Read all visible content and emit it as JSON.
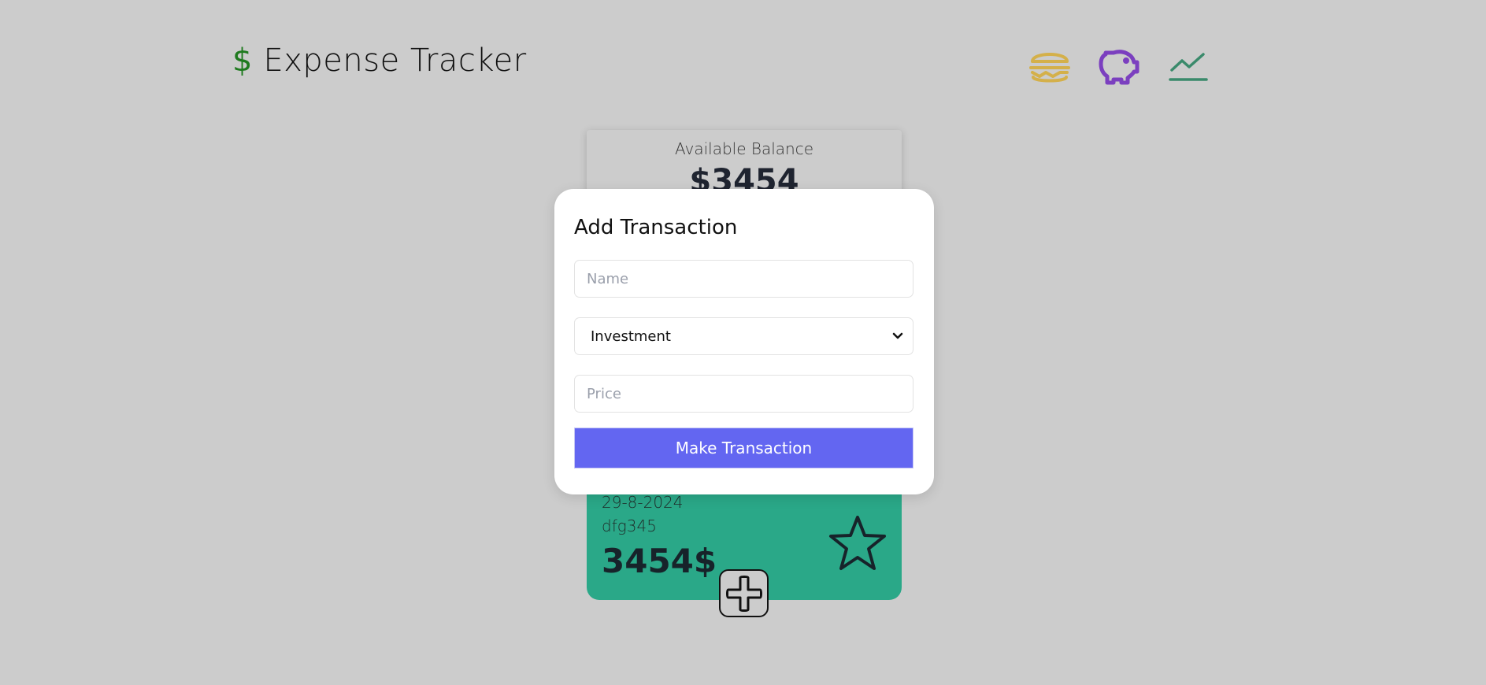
{
  "header": {
    "currency_symbol": "$",
    "title": "Expense Tracker"
  },
  "nav": {
    "icons": [
      "burger-icon",
      "piggy-bank-icon",
      "chart-line-icon"
    ],
    "colors": {
      "burger": "#d4b04a",
      "piggy": "#7b3fbf",
      "chart": "#3a8a6b"
    }
  },
  "balance": {
    "label": "Available Balance",
    "value": "$3454"
  },
  "transaction_card": {
    "date": "29-8-2024",
    "name": "dfg345",
    "amount": "3454$",
    "color": "#2aa888"
  },
  "modal": {
    "title": "Add Transaction",
    "name_placeholder": "Name",
    "category_selected": "Investment",
    "price_placeholder": "Price",
    "submit_label": "Make Transaction",
    "accent": "#6366f1"
  }
}
